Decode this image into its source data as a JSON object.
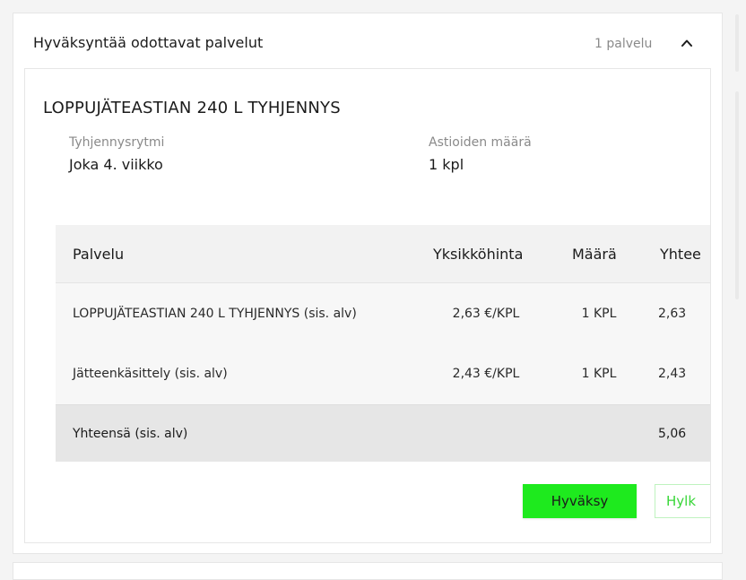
{
  "section": {
    "title": "Hyväksyntää odottavat palvelut",
    "count": "1 palvelu"
  },
  "service": {
    "title": "LOPPUJÄTEASTIAN 240 L TYHJENNYS",
    "frequency_label": "Tyhjennysrytmi",
    "frequency_value": "Joka 4. viikko",
    "containers_label": "Astioiden määrä",
    "containers_value": "1 kpl"
  },
  "table": {
    "headers": [
      "Palvelu",
      "Yksikköhinta",
      "Määrä",
      "Yhtee"
    ],
    "rows": [
      [
        "LOPPUJÄTEASTIAN 240 L TYHJENNYS (sis. alv)",
        "2,63 €/KPL",
        "1 KPL",
        "2,63"
      ],
      [
        "Jätteenkäsittely (sis. alv)",
        "2,43 €/KPL",
        "1 KPL",
        "2,43"
      ]
    ],
    "total_label": "Yhteensä (sis. alv)",
    "total_value": "5,06"
  },
  "actions": {
    "approve": "Hyväksy",
    "reject": "Hylk"
  },
  "colors": {
    "accent": "#1eea1e",
    "reject_text": "#37d637"
  },
  "icons": {
    "collapse": "chevron-up-icon"
  }
}
